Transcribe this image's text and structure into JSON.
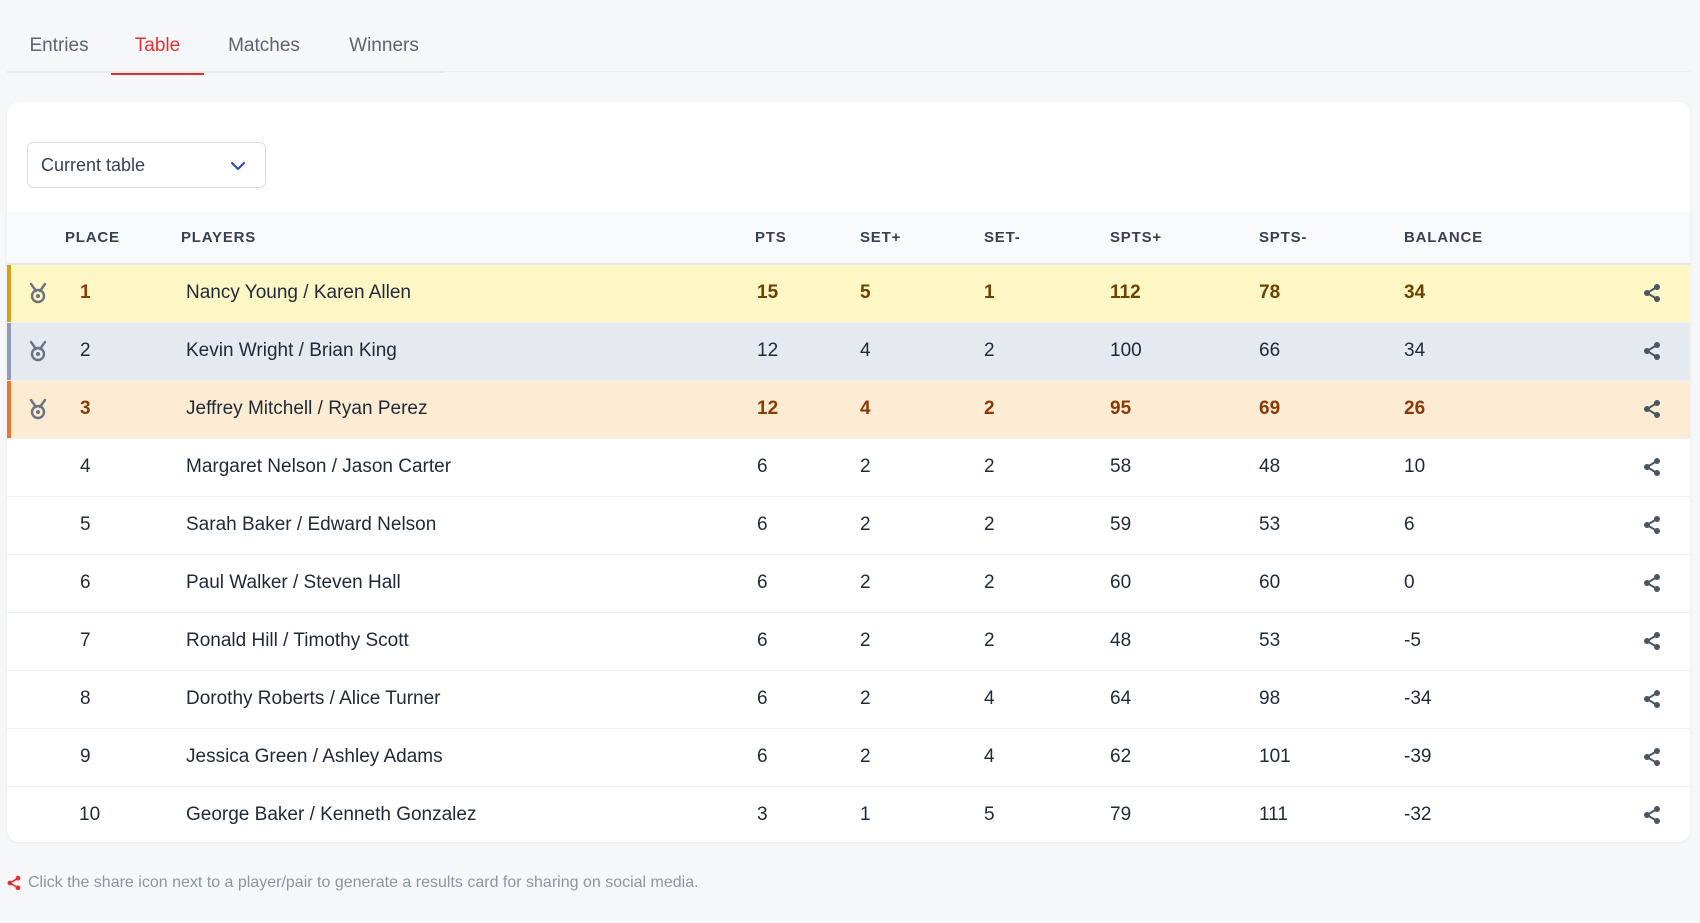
{
  "tabs": [
    {
      "label": "Entries",
      "active": false
    },
    {
      "label": "Table",
      "active": true
    },
    {
      "label": "Matches",
      "active": false
    },
    {
      "label": "Winners",
      "active": false
    }
  ],
  "select": {
    "value": "Current table"
  },
  "table": {
    "headers": {
      "place": "PLACE",
      "players": "PLAYERS",
      "pts": "PTS",
      "set_plus": "SET+",
      "set_minus": "SET-",
      "spts_plus": "SPTS+",
      "spts_minus": "SPTS-",
      "balance": "BALANCE"
    },
    "rows": [
      {
        "place": "1",
        "players": "Nancy Young / Karen Allen",
        "pts": "15",
        "set_plus": "5",
        "set_minus": "1",
        "spts_plus": "112",
        "spts_minus": "78",
        "balance": "34",
        "medal": "gold"
      },
      {
        "place": "2",
        "players": "Kevin Wright / Brian King",
        "pts": "12",
        "set_plus": "4",
        "set_minus": "2",
        "spts_plus": "100",
        "spts_minus": "66",
        "balance": "34",
        "medal": "silver"
      },
      {
        "place": "3",
        "players": "Jeffrey Mitchell / Ryan Perez",
        "pts": "12",
        "set_plus": "4",
        "set_minus": "2",
        "spts_plus": "95",
        "spts_minus": "69",
        "balance": "26",
        "medal": "bronze"
      },
      {
        "place": "4",
        "players": "Margaret Nelson / Jason Carter",
        "pts": "6",
        "set_plus": "2",
        "set_minus": "2",
        "spts_plus": "58",
        "spts_minus": "48",
        "balance": "10",
        "medal": ""
      },
      {
        "place": "5",
        "players": "Sarah Baker / Edward Nelson",
        "pts": "6",
        "set_plus": "2",
        "set_minus": "2",
        "spts_plus": "59",
        "spts_minus": "53",
        "balance": "6",
        "medal": ""
      },
      {
        "place": "6",
        "players": "Paul Walker / Steven Hall",
        "pts": "6",
        "set_plus": "2",
        "set_minus": "2",
        "spts_plus": "60",
        "spts_minus": "60",
        "balance": "0",
        "medal": ""
      },
      {
        "place": "7",
        "players": "Ronald Hill / Timothy Scott",
        "pts": "6",
        "set_plus": "2",
        "set_minus": "2",
        "spts_plus": "48",
        "spts_minus": "53",
        "balance": "-5",
        "medal": ""
      },
      {
        "place": "8",
        "players": "Dorothy Roberts / Alice Turner",
        "pts": "6",
        "set_plus": "2",
        "set_minus": "4",
        "spts_plus": "64",
        "spts_minus": "98",
        "balance": "-34",
        "medal": ""
      },
      {
        "place": "9",
        "players": "Jessica Green / Ashley Adams",
        "pts": "6",
        "set_plus": "2",
        "set_minus": "4",
        "spts_plus": "62",
        "spts_minus": "101",
        "balance": "-39",
        "medal": ""
      },
      {
        "place": "10",
        "players": "George Baker / Kenneth Gonzalez",
        "pts": "3",
        "set_plus": "1",
        "set_minus": "5",
        "spts_plus": "79",
        "spts_minus": "111",
        "balance": "-32",
        "medal": ""
      }
    ]
  },
  "footnote": {
    "text": "Click the share icon next to a player/pair to generate a results card for sharing on social media."
  },
  "icons": {
    "medal": "medal-icon",
    "share": "share-icon",
    "chevron": "chevron-down-icon"
  },
  "colors": {
    "accent": "#e03131",
    "gold_row": "#fdf6c5",
    "silver_row": "#e5e9f0",
    "bronze_row": "#fdebd3"
  }
}
